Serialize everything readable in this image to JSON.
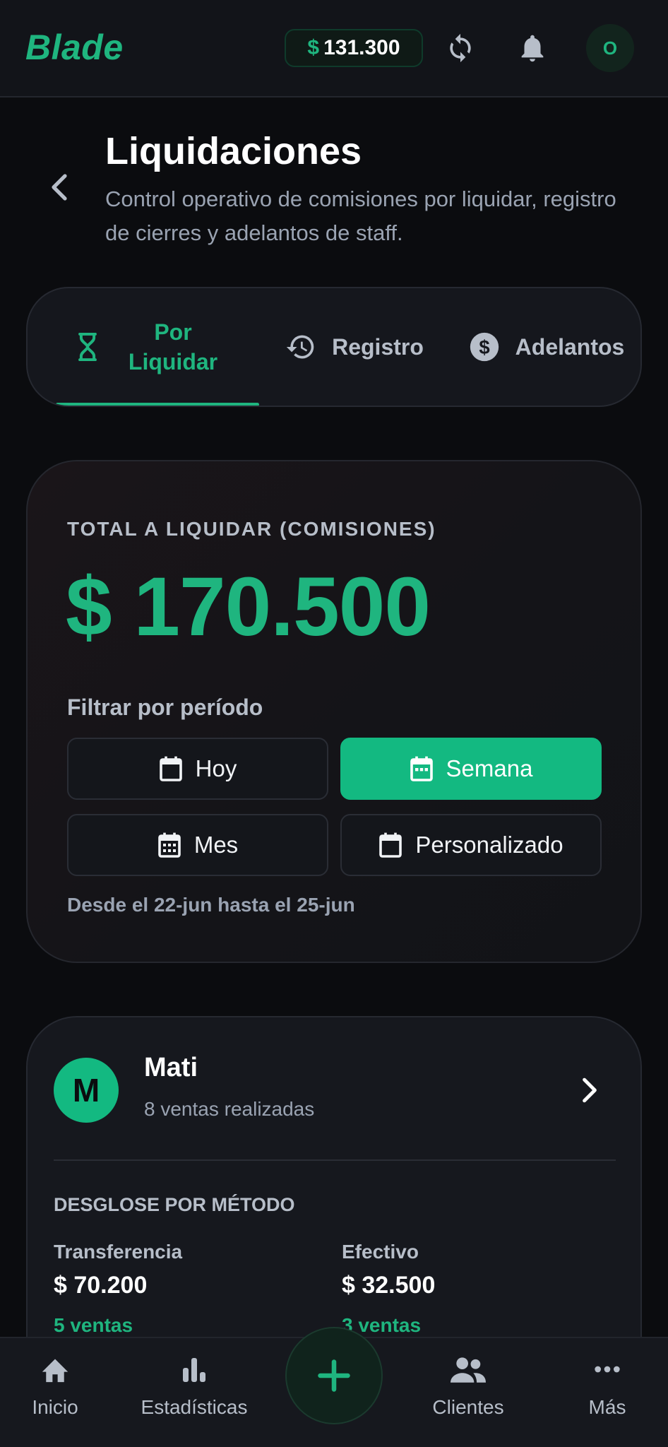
{
  "topbar": {
    "brand": "Blade",
    "balance_currency": "$",
    "balance_amount": "131.300",
    "sync_icon": "sync-icon",
    "notifications_icon": "bell-icon",
    "avatar_initial": "O"
  },
  "header": {
    "back_icon": "chevron-left-icon",
    "title": "Liquidaciones",
    "subtitle": "Control operativo de comisiones por liquidar, registro de cierres y adelantos de staff."
  },
  "tabs": [
    {
      "label": "Por Liquidar",
      "icon": "hourglass-icon",
      "active": true
    },
    {
      "label": "Registro",
      "icon": "history-icon",
      "active": false
    },
    {
      "label": "Adelantos",
      "icon": "dollar-circle-icon",
      "active": false
    }
  ],
  "summary": {
    "label": "TOTAL A LIQUIDAR (COMISIONES)",
    "amount": "$ 170.500",
    "filter_label": "Filtrar por período",
    "filters": [
      {
        "label": "Hoy",
        "icon": "calendar-icon",
        "active": false
      },
      {
        "label": "Semana",
        "icon": "calendar-week-icon",
        "active": true
      },
      {
        "label": "Mes",
        "icon": "calendar-month-icon",
        "active": false
      },
      {
        "label": "Personalizado",
        "icon": "calendar-icon",
        "active": false
      }
    ],
    "range_text": "Desde el 22-jun hasta el 25-jun"
  },
  "staff": {
    "initial": "M",
    "name": "Mati",
    "sales_text": "8 ventas realizadas",
    "breakdown_title": "DESGLOSE POR MÉTODO",
    "methods": [
      {
        "name": "Transferencia",
        "amount": "$ 70.200",
        "count": "5 ventas"
      },
      {
        "name": "Efectivo",
        "amount": "$ 32.500",
        "count": "3 ventas"
      }
    ]
  },
  "bottom_nav": {
    "items": [
      {
        "label": "Inicio",
        "icon": "home-icon"
      },
      {
        "label": "Estadísticas",
        "icon": "bar-chart-icon"
      },
      {
        "label": "Clientes",
        "icon": "people-icon"
      },
      {
        "label": "Más",
        "icon": "more-horizontal-icon"
      }
    ],
    "fab_icon": "plus-icon"
  },
  "colors": {
    "accent": "#13b981",
    "background": "#0b0c0f",
    "surface": "#16181e",
    "muted_text": "#9aa3b2"
  }
}
